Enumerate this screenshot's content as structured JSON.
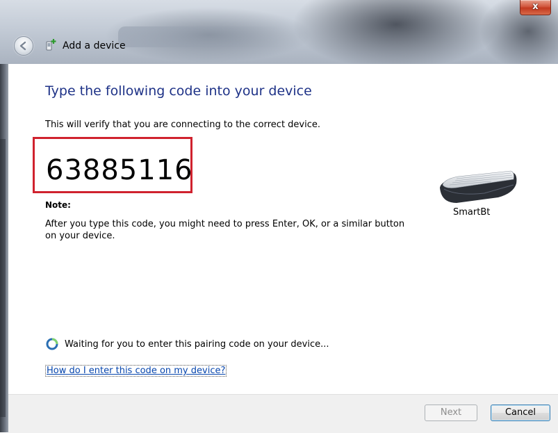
{
  "window": {
    "title": "Add a device",
    "close_symbol": "x"
  },
  "main": {
    "heading": "Type the following code into your device",
    "subtext": "This will verify that you are connecting to the correct device.",
    "pairing_code": "63885116",
    "note_label": "Note:",
    "note_text": "After you type this code, you might need to press Enter, OK, or a similar button on your device.",
    "device_name": "SmartBt",
    "device_icon": "keyboard-icon",
    "status_text": "Waiting for you to enter this pairing code on your device...",
    "help_link": "How do I enter this code on my device?"
  },
  "footer": {
    "next_label": "Next",
    "cancel_label": "Cancel"
  },
  "colors": {
    "heading": "#1e3287",
    "code_highlight": "#d0222e",
    "link": "#0645ad"
  }
}
